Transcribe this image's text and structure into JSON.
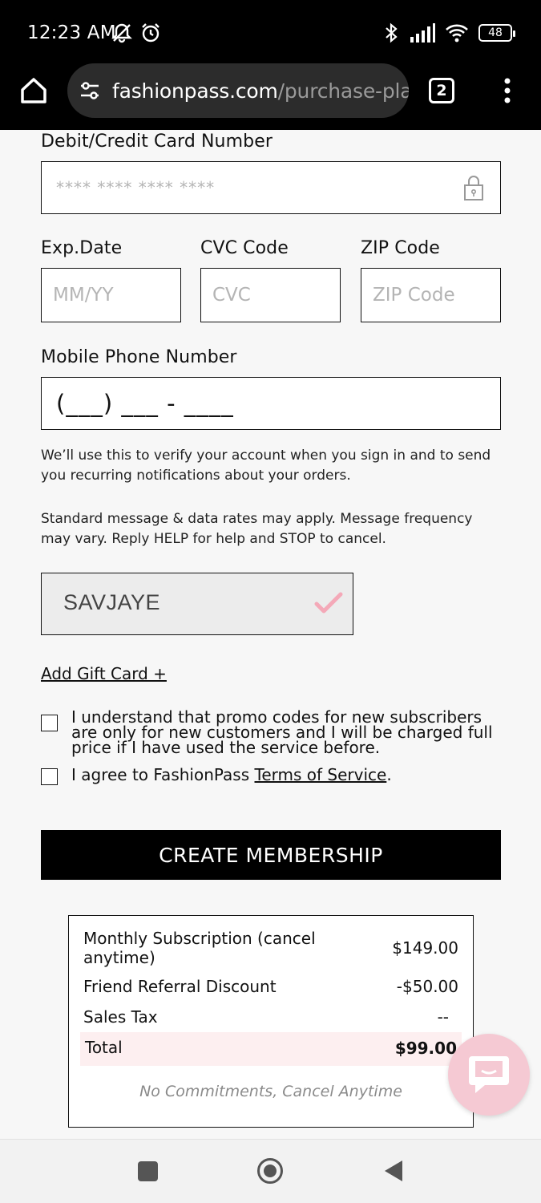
{
  "status_bar": {
    "time": "12:23 AM",
    "battery": "48"
  },
  "browser": {
    "url_domain": "fashionpass.com",
    "url_path": "/purchase-plan",
    "tab_count": "2"
  },
  "form": {
    "card_label": "Debit/Credit Card Number",
    "card_placeholder": "**** **** **** ****",
    "exp_label": "Exp.Date",
    "exp_placeholder": "MM/YY",
    "cvc_label": "CVC Code",
    "cvc_placeholder": "CVC",
    "zip_label": "ZIP Code",
    "zip_placeholder": "ZIP Code",
    "phone_label": "Mobile Phone Number",
    "phone_placeholder": "(___) ___ - ____",
    "phone_help": "We’ll use this to verify your account when you sign in and to send you recurring notifications about your orders.",
    "rates_help": "Standard message & data rates may apply. Message frequency may vary. Reply HELP for help and STOP to cancel.",
    "promo_code": "SAVJAYE",
    "gift_card_link": "Add Gift Card +",
    "promo_agreement": "I understand that promo codes for new subscribers are only for new customers and I will be charged full price if I have used the service before.",
    "tos_prefix": "I agree to FashionPass",
    "tos_link": "Terms of Service",
    "tos_suffix": ".",
    "submit_label": "CREATE MEMBERSHIP"
  },
  "summary": {
    "rows": [
      {
        "label": "Monthly Subscription (cancel anytime)",
        "value": "$149.00"
      },
      {
        "label": "Friend Referral Discount",
        "value": "-$50.00"
      },
      {
        "label": "Sales Tax",
        "value": "--"
      }
    ],
    "total_label": "Total",
    "total_value": "$99.00",
    "footer_note": "No Commitments, Cancel Anytime"
  },
  "colors": {
    "accent_pink": "#f5c9d3",
    "checkmark_pink": "#f4a9b8",
    "total_bg": "#fdeff0"
  }
}
